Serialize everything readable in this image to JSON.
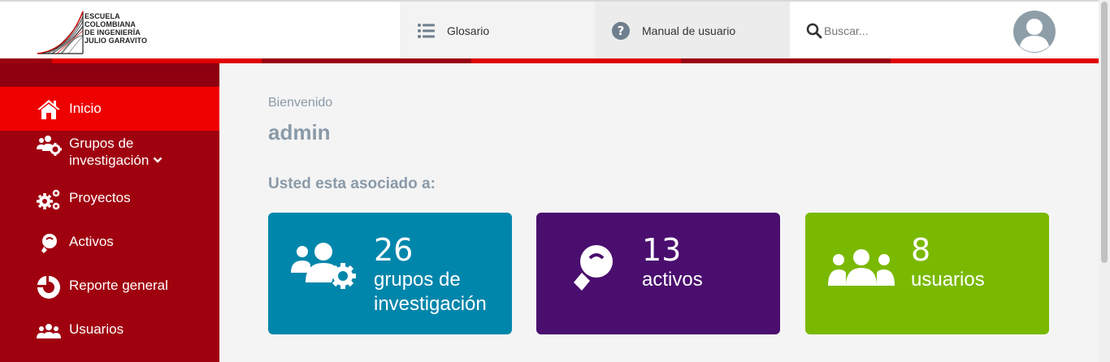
{
  "header": {
    "logo_text": "ESCUELA\nCOLOMBIANA\nDE INGENIERÍA\nJULIO GARAVITO",
    "nav": [
      {
        "label": "Glosario",
        "icon": "list-icon"
      },
      {
        "label": "Manual de usuario",
        "icon": "question-circle-icon"
      }
    ],
    "search": {
      "placeholder": "Buscar...",
      "value": "",
      "icon": "search-icon"
    },
    "avatar_icon": "user-avatar-icon"
  },
  "sidebar": {
    "items": [
      {
        "label": "Inicio",
        "icon": "home-icon",
        "active": true
      },
      {
        "label": "Grupos de\ninvestigación",
        "icon": "users-cog-icon",
        "expandable": true
      },
      {
        "label": "Proyectos",
        "icon": "cogs-icon"
      },
      {
        "label": "Activos",
        "icon": "lightbulb-icon"
      },
      {
        "label": "Reporte general",
        "icon": "pie-chart-icon"
      },
      {
        "label": "Usuarios",
        "icon": "users-icon"
      }
    ]
  },
  "main": {
    "welcome": "Bienvenido",
    "username": "admin",
    "associated_label": "Usted esta asociado a:",
    "cards": [
      {
        "number": "26",
        "label": "grupos de investigación",
        "icon": "users-cog-icon",
        "color": "#0186ab"
      },
      {
        "number": "13",
        "label": "activos",
        "icon": "lightbulb-icon",
        "color": "#4a0e6e"
      },
      {
        "number": "8",
        "label": "usuarios",
        "icon": "users-icon",
        "color": "#7ab901"
      }
    ]
  },
  "colors": {
    "accent_red": "#ee0101",
    "sidebar_red": "#a0010f",
    "text_muted": "#8a9aa8"
  }
}
